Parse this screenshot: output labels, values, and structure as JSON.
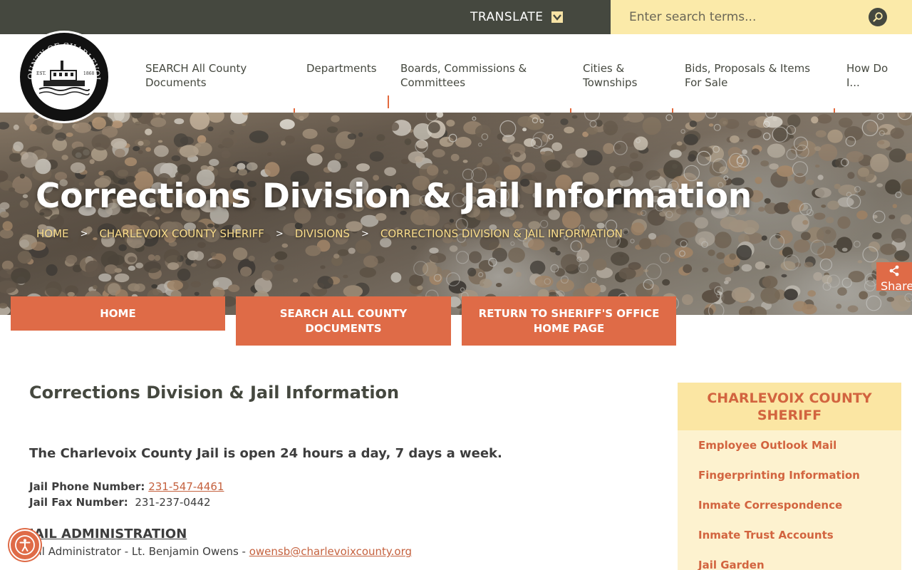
{
  "topbar": {
    "translate_label": "TRANSLATE",
    "search_placeholder": "Enter search terms...",
    "colors": {
      "bar": "#45483f",
      "search_bg": "#fbeaa9"
    }
  },
  "logo": {
    "top_text": "COUNTY OF CHARLEVOIX",
    "bottom_text": "Ironton Ferry 1883",
    "est": "EST.",
    "year": "1868"
  },
  "nav": {
    "items": [
      {
        "label_line1": "SEARCH All County",
        "label_line2": "Documents"
      },
      {
        "label_line1": "Departments",
        "label_line2": ""
      },
      {
        "label_line1": "Boards, Commissions &",
        "label_line2": "Committees"
      },
      {
        "label_line1": "Cities &",
        "label_line2": "Townships"
      },
      {
        "label_line1": "Bids, Proposals & Items",
        "label_line2": "For Sale"
      },
      {
        "label_line1": "How Do",
        "label_line2": "I..."
      }
    ]
  },
  "hero": {
    "title": "Corrections Division & Jail Information",
    "breadcrumb": [
      "HOME",
      "CHARLEVOIX COUNTY SHERIFF",
      "DIVISIONS",
      "CORRECTIONS DIVISION & JAIL INFORMATION"
    ],
    "separator": ">"
  },
  "share": {
    "label": "Share"
  },
  "quick_buttons": [
    {
      "line1": "HOME",
      "line2": ""
    },
    {
      "line1": "SEARCH ALL COUNTY",
      "line2": "DOCUMENTS"
    },
    {
      "line1": "RETURN TO SHERIFF'S OFFICE",
      "line2": "HOME PAGE"
    }
  ],
  "main": {
    "heading": "Corrections Division & Jail Information",
    "lead": "The Charlevoix County Jail is open 24 hours a day, 7 days a week.",
    "phone_label": "Jail Phone Number:",
    "phone_value": "231-547-4461",
    "fax_label": "Jail Fax Number:",
    "fax_value": "231-237-0442",
    "admin_heading": "JAIL ADMINISTRATION",
    "admin_text": "Jail Administrator - Lt. Benjamin Owens - ",
    "admin_email": "owensb@charlevoixcounty.org"
  },
  "sidebar": {
    "title_line1": "CHARLEVOIX COUNTY",
    "title_line2": "SHERIFF",
    "links": [
      "Employee Outlook Mail",
      "Fingerprinting Information",
      "Inmate Correspondence",
      "Inmate Trust Accounts",
      "Jail Garden"
    ]
  },
  "accent_color": "#df6b47"
}
